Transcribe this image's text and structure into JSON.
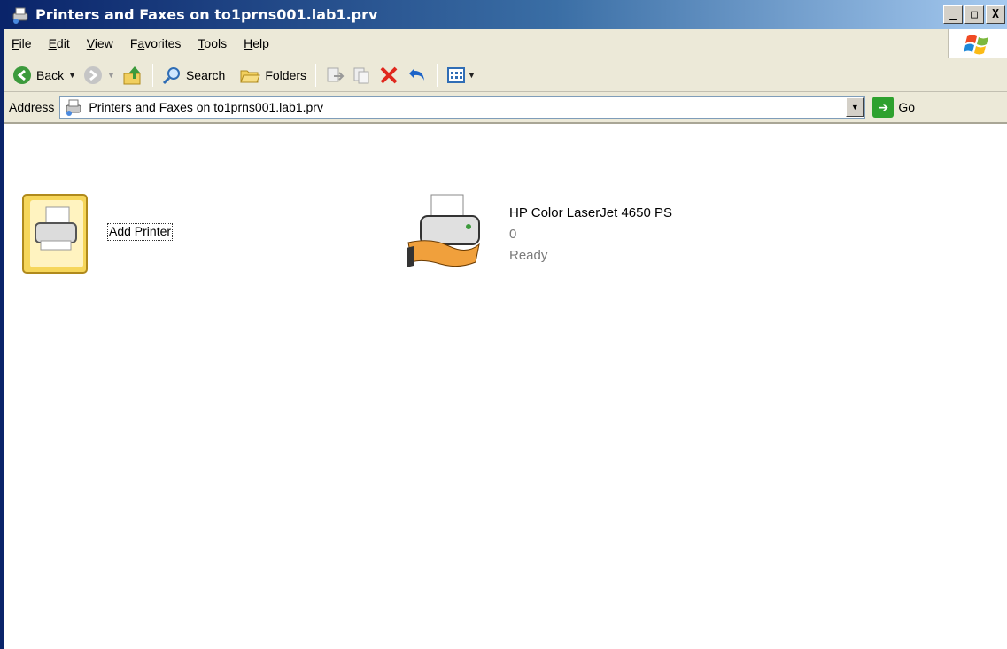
{
  "window": {
    "title": "Printers and Faxes on to1prns001.lab1.prv",
    "min_button": "_",
    "max_button": "□",
    "close_button": "X"
  },
  "menu": {
    "items": [
      {
        "label": "File",
        "key": "F"
      },
      {
        "label": "Edit",
        "key": "E"
      },
      {
        "label": "View",
        "key": "V"
      },
      {
        "label": "Favorites",
        "key": "a"
      },
      {
        "label": "Tools",
        "key": "T"
      },
      {
        "label": "Help",
        "key": "H"
      }
    ]
  },
  "toolbar": {
    "back_label": "Back",
    "search_label": "Search",
    "folders_label": "Folders"
  },
  "address": {
    "label": "Address",
    "value": "Printers and Faxes on to1prns001.lab1.prv",
    "go_label": "Go"
  },
  "items": {
    "add_printer": {
      "label": "Add Printer"
    },
    "printer": {
      "name": "HP Color LaserJet 4650 PS",
      "jobs": "0",
      "status": "Ready"
    }
  },
  "colors": {
    "titlebar": "#0a246a",
    "chrome": "#ece9d8",
    "go": "#2ea12e",
    "delete": "#e0281e"
  }
}
